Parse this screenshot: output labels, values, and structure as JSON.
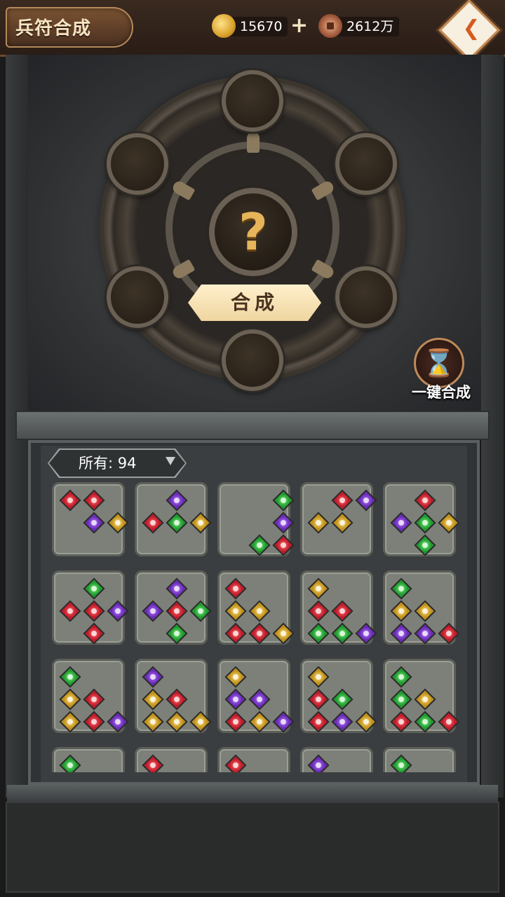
{
  "header": {
    "title": "兵符合成",
    "gold_amount": "15670",
    "copper_amount": "2612万",
    "add_symbol": "+",
    "back_icon": "back-arrow-icon"
  },
  "forge": {
    "center_symbol": "?",
    "craft_button_label": "合成",
    "one_key_label": "一键合成",
    "one_key_icon": "hourglass-icon",
    "slots_count": 6
  },
  "inventory": {
    "filter_label": "所有: 94",
    "colors": {
      "r": "#c01a2a",
      "p": "#6a2ab8",
      "g": "#1e9a2e",
      "y": "#c0901a"
    },
    "cards": [
      {
        "gems": [
          [
            "r",
            "r",
            ""
          ],
          [
            "",
            "p",
            "y"
          ],
          [
            "",
            "",
            ""
          ]
        ]
      },
      {
        "gems": [
          [
            "",
            "p",
            ""
          ],
          [
            "r",
            "g",
            "y"
          ],
          [
            "",
            "",
            ""
          ]
        ]
      },
      {
        "gems": [
          [
            "",
            "",
            "g"
          ],
          [
            "",
            "",
            "p"
          ],
          [
            "",
            "g",
            "r"
          ]
        ]
      },
      {
        "gems": [
          [
            "",
            "r",
            "p"
          ],
          [
            "y",
            "y",
            ""
          ],
          [
            "",
            "",
            ""
          ]
        ]
      },
      {
        "gems": [
          [
            "",
            "r",
            ""
          ],
          [
            "p",
            "g",
            "y"
          ],
          [
            "",
            "g",
            ""
          ]
        ]
      },
      {
        "gems": [
          [
            "",
            "g",
            ""
          ],
          [
            "r",
            "r",
            "p"
          ],
          [
            "",
            "r",
            ""
          ]
        ]
      },
      {
        "gems": [
          [
            "",
            "p",
            ""
          ],
          [
            "p",
            "r",
            "g"
          ],
          [
            "",
            "g",
            ""
          ]
        ]
      },
      {
        "gems": [
          [
            "r",
            "",
            ""
          ],
          [
            "y",
            "y",
            ""
          ],
          [
            "r",
            "r",
            "y"
          ]
        ]
      },
      {
        "gems": [
          [
            "y",
            "",
            ""
          ],
          [
            "r",
            "r",
            ""
          ],
          [
            "g",
            "g",
            "p"
          ]
        ]
      },
      {
        "gems": [
          [
            "g",
            "",
            ""
          ],
          [
            "y",
            "y",
            ""
          ],
          [
            "p",
            "p",
            "r"
          ]
        ]
      },
      {
        "gems": [
          [
            "g",
            "",
            ""
          ],
          [
            "y",
            "r",
            ""
          ],
          [
            "y",
            "r",
            "p"
          ]
        ]
      },
      {
        "gems": [
          [
            "p",
            "",
            ""
          ],
          [
            "y",
            "r",
            ""
          ],
          [
            "y",
            "y",
            "y"
          ]
        ]
      },
      {
        "gems": [
          [
            "y",
            "",
            ""
          ],
          [
            "p",
            "p",
            ""
          ],
          [
            "r",
            "y",
            "p"
          ]
        ]
      },
      {
        "gems": [
          [
            "y",
            "",
            ""
          ],
          [
            "r",
            "g",
            ""
          ],
          [
            "r",
            "p",
            "y"
          ]
        ]
      },
      {
        "gems": [
          [
            "g",
            "",
            ""
          ],
          [
            "g",
            "y",
            ""
          ],
          [
            "r",
            "g",
            "r"
          ]
        ]
      },
      {
        "gems": [
          [
            "g",
            "",
            ""
          ],
          [
            "",
            "",
            " "
          ],
          [
            "",
            "",
            ""
          ]
        ]
      },
      {
        "gems": [
          [
            "r",
            "",
            ""
          ],
          [
            "",
            "",
            ""
          ],
          [
            "",
            "",
            ""
          ]
        ]
      },
      {
        "gems": [
          [
            "r",
            "",
            ""
          ],
          [
            "",
            "",
            ""
          ],
          [
            "",
            "",
            ""
          ]
        ]
      },
      {
        "gems": [
          [
            "p",
            "",
            ""
          ],
          [
            "",
            "",
            ""
          ],
          [
            "",
            "",
            ""
          ]
        ]
      },
      {
        "gems": [
          [
            "g",
            "",
            ""
          ],
          [
            "",
            "",
            ""
          ],
          [
            "",
            "",
            ""
          ]
        ]
      }
    ]
  }
}
